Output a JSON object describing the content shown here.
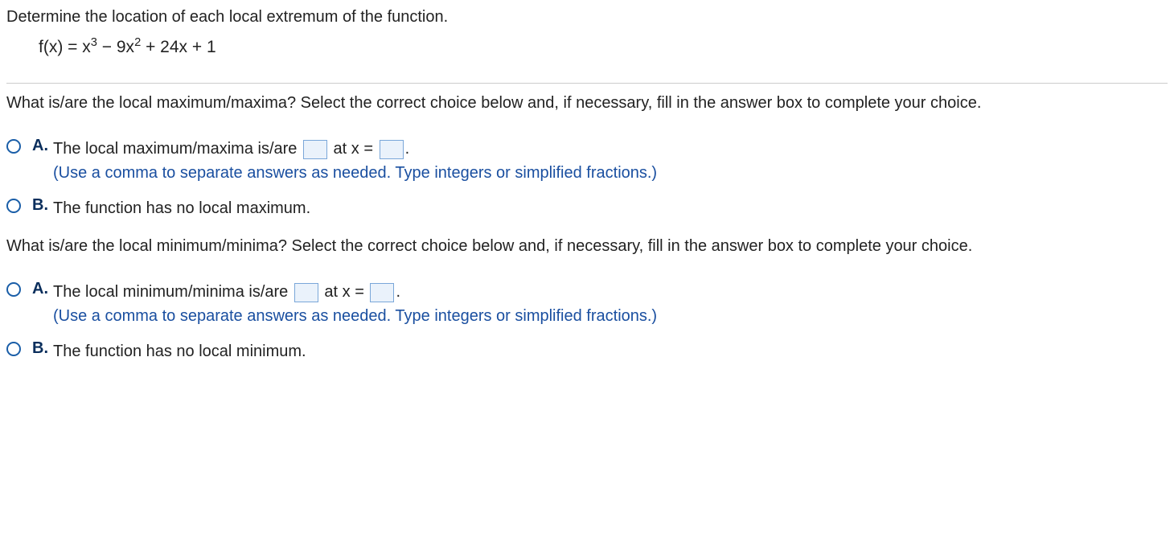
{
  "header": {
    "prompt": "Determine the location of each local extremum of the function.",
    "equation_html": "f(x) = x<sup>3</sup> − 9x<sup>2</sup> + 24x + 1"
  },
  "q1": {
    "text": "What is/are the local maximum/maxima? Select the correct choice below and, if necessary, fill in the answer box to complete your choice.",
    "choiceA": {
      "label": "A.",
      "pre": "The local maximum/maxima is/are ",
      "mid": " at x = ",
      "post": ".",
      "hint": "(Use a comma to separate answers as needed. Type integers or simplified fractions.)"
    },
    "choiceB": {
      "label": "B.",
      "text": "The function has no local maximum."
    }
  },
  "q2": {
    "text": "What is/are the local minimum/minima? Select the correct choice below and, if necessary, fill in the answer box to complete your choice.",
    "choiceA": {
      "label": "A.",
      "pre": "The local minimum/minima is/are ",
      "mid": " at x = ",
      "post": ".",
      "hint": "(Use a comma to separate answers as needed. Type integers or simplified fractions.)"
    },
    "choiceB": {
      "label": "B.",
      "text": "The function has no local minimum."
    }
  }
}
